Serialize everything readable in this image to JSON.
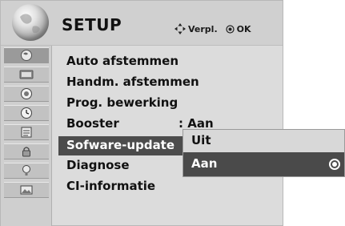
{
  "header": {
    "title": "SETUP",
    "nav_hint": "Verpl.",
    "ok_hint": "OK"
  },
  "sidebar": {
    "icons": [
      {
        "name": "setup-icon",
        "selected": true
      },
      {
        "name": "picture-icon",
        "selected": false
      },
      {
        "name": "audio-icon",
        "selected": false
      },
      {
        "name": "time-icon",
        "selected": false
      },
      {
        "name": "option-icon",
        "selected": false
      },
      {
        "name": "lock-icon",
        "selected": false
      },
      {
        "name": "support-icon",
        "selected": false
      },
      {
        "name": "media-icon",
        "selected": false
      }
    ]
  },
  "menu": {
    "items": [
      {
        "label": "Auto afstemmen"
      },
      {
        "label": "Handm. afstemmen"
      },
      {
        "label": "Prog. bewerking"
      },
      {
        "label": "Booster",
        "value": ": Aan"
      },
      {
        "label": "Sofware-update",
        "selected": true
      },
      {
        "label": "Diagnose"
      },
      {
        "label": "CI-informatie"
      }
    ]
  },
  "popup": {
    "options": [
      {
        "label": "Uit",
        "selected": false
      },
      {
        "label": "Aan",
        "selected": true
      }
    ]
  },
  "colors": {
    "panel_bg": "#dcdcdc",
    "header_bg": "#d0d0d0",
    "selection_bg": "#4c4c4c",
    "text": "#111111",
    "selected_text": "#ffffff"
  }
}
